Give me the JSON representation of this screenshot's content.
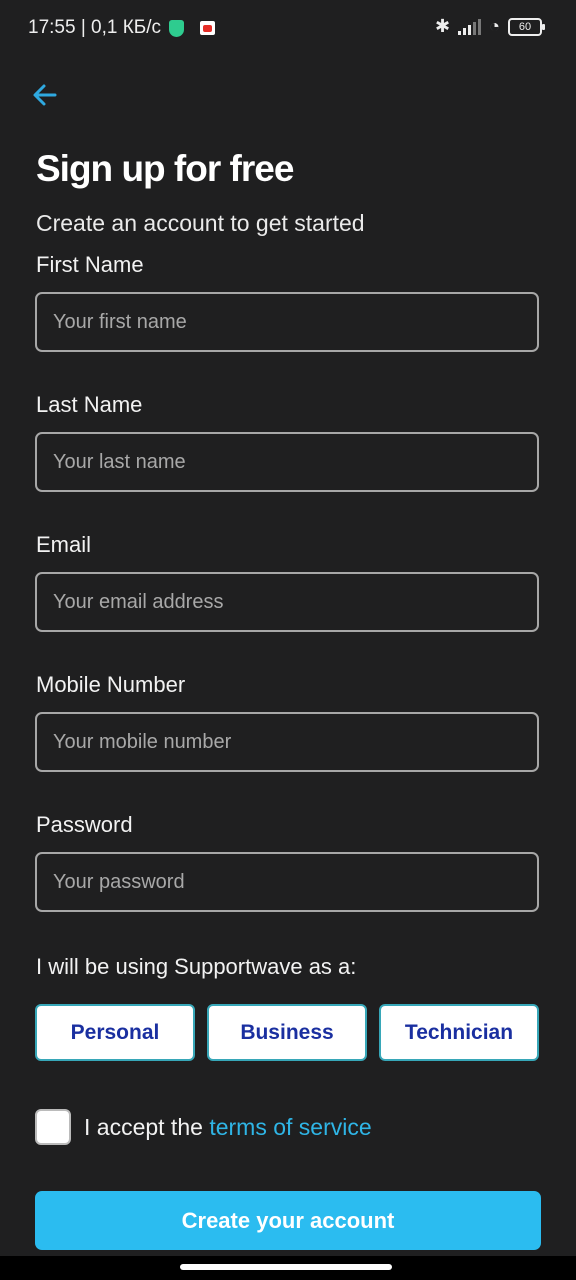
{
  "status_bar": {
    "time_speed": "17:55 | 0,1 КБ/с",
    "battery": "60"
  },
  "header": {
    "title": "Sign up for free",
    "subtitle": "Create an account to get started"
  },
  "fields": [
    {
      "label": "First Name",
      "placeholder": "Your first name",
      "value": ""
    },
    {
      "label": "Last Name",
      "placeholder": "Your last name",
      "value": ""
    },
    {
      "label": "Email",
      "placeholder": "Your email address",
      "value": ""
    },
    {
      "label": "Mobile Number",
      "placeholder": "Your mobile number",
      "value": ""
    },
    {
      "label": "Password",
      "placeholder": "Your password",
      "value": ""
    }
  ],
  "role": {
    "prompt": "I will be using Supportwave as a:",
    "options": [
      "Personal",
      "Business",
      "Technician"
    ]
  },
  "terms": {
    "prefix": "I accept the",
    "link": "terms of service",
    "checked": false
  },
  "submit_label": "Create your account",
  "colors": {
    "accent": "#2bbcf0",
    "link": "#2fb5e6",
    "role_text": "#1a2fa0",
    "background": "#1f1f20"
  }
}
